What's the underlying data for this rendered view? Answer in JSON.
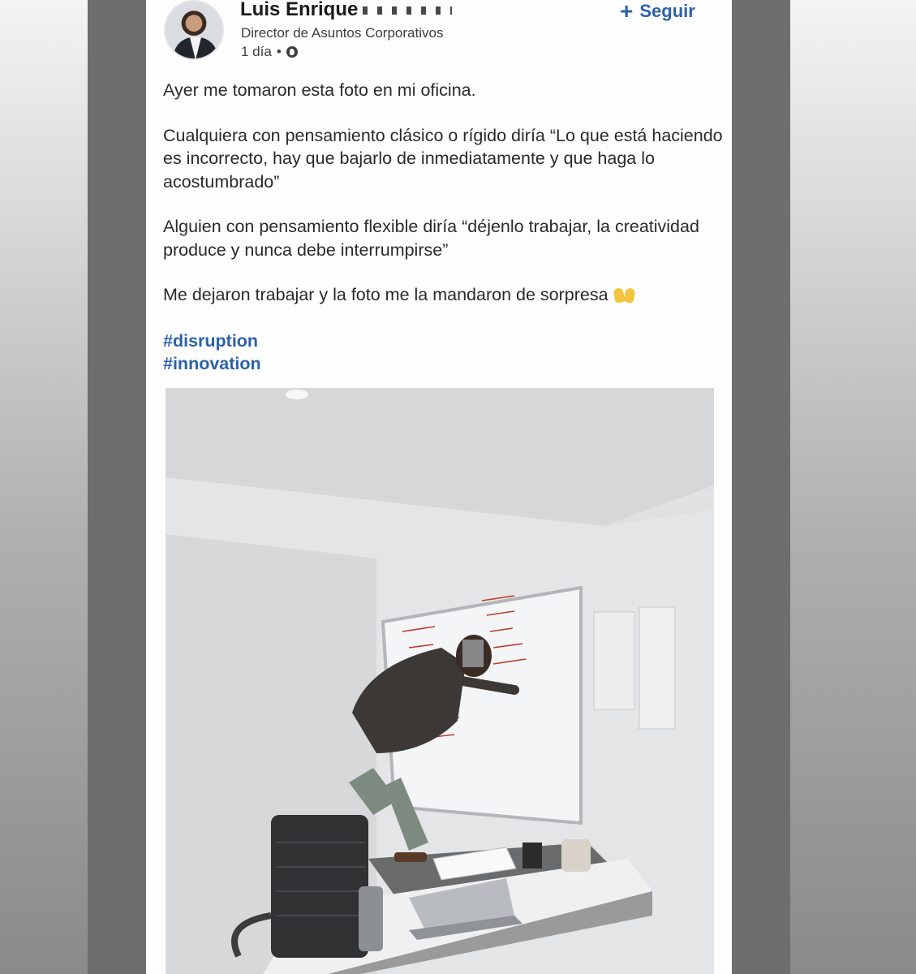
{
  "post": {
    "author_name": "Luis Enrique",
    "author_headline": "Director de Asuntos Corporativos",
    "time": "1 día",
    "dot": "•",
    "follow_label": "Seguir",
    "follow_icon": "plus-icon",
    "paragraphs": [
      "Ayer me tomaron esta foto en mi oficina.",
      "Cualquiera con pensamiento clásico o rígido diría “Lo que está haciendo es incorrecto, hay que bajarlo de inmediatamente y que haga lo acostumbrado”",
      "Alguien con pensamiento flexible diría “déjenlo trabajar, la creatividad produce y nunca debe interrumpirse”",
      "Me dejaron trabajar y la foto me la mandaron de sorpresa"
    ],
    "emoji": "raising-hands-icon",
    "hashtags": [
      "#disruption",
      "#innovation"
    ]
  },
  "colors": {
    "link": "#2c62a8",
    "text": "#2a2a2a",
    "whiteboard_marker": "#c0392b"
  }
}
